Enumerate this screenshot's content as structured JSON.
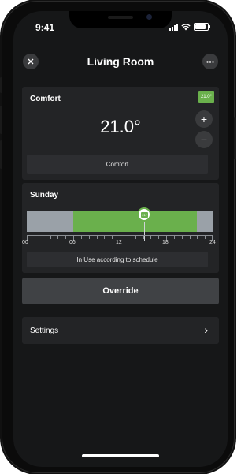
{
  "status_bar": {
    "time": "9:41",
    "signal_icon": "cellular-signal-icon",
    "wifi_icon": "wifi-icon",
    "battery_icon": "battery-icon"
  },
  "header": {
    "title": "Living Room",
    "close_icon": "close-icon",
    "more_icon": "more-options-icon"
  },
  "comfort_card": {
    "label": "Comfort",
    "setpoint_badge": "21.0°",
    "current_temperature": "21.0°",
    "plus_label": "+",
    "minus_label": "−",
    "mode_label": "Comfort"
  },
  "schedule_card": {
    "day": "Sunday",
    "tick_labels": [
      "00",
      "06",
      "12",
      "18",
      "24"
    ],
    "comfort_period_hours": {
      "start": 6,
      "end": 22
    },
    "current_time_hours": 15.2,
    "marker_badge": "21°",
    "status_text": "In Use according to schedule"
  },
  "override_button": {
    "label": "Override"
  },
  "settings_row": {
    "label": "Settings",
    "chevron": "›"
  },
  "colors": {
    "accent_green": "#6ab04c",
    "card_bg": "#232426",
    "screen_bg": "#161718"
  }
}
